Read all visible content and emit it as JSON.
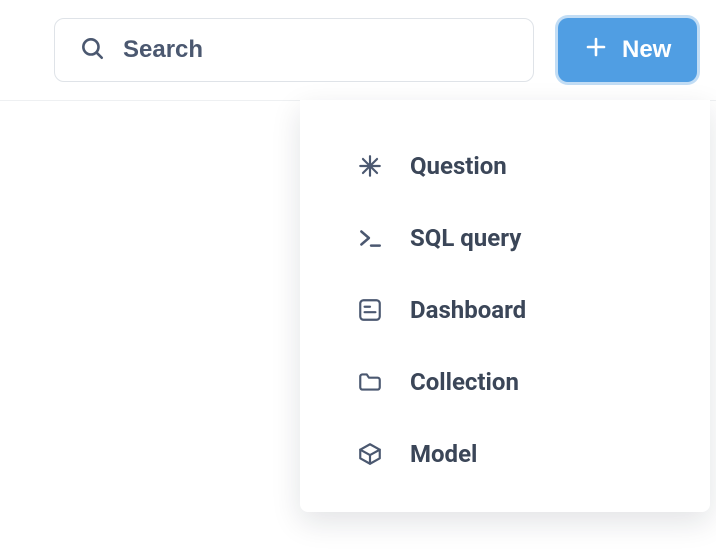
{
  "header": {
    "search": {
      "placeholder": "Search"
    },
    "new_button": {
      "label": "New"
    }
  },
  "new_menu": {
    "items": [
      {
        "icon": "star-icon",
        "label": "Question"
      },
      {
        "icon": "sql-icon",
        "label": "SQL query"
      },
      {
        "icon": "dashboard-icon",
        "label": "Dashboard"
      },
      {
        "icon": "folder-icon",
        "label": "Collection"
      },
      {
        "icon": "model-icon",
        "label": "Model"
      }
    ]
  }
}
